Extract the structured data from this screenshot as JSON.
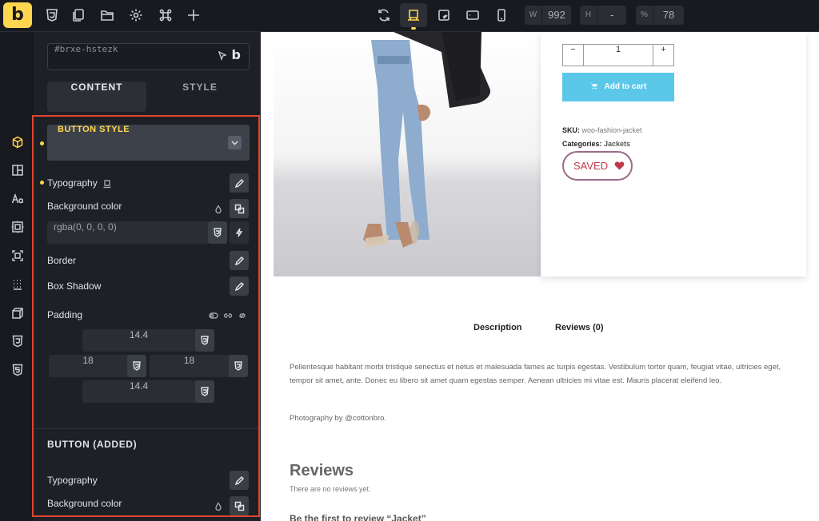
{
  "topbar": {
    "logo": "b",
    "icons": [
      "css3-icon",
      "pages-icon",
      "folder-icon",
      "settings-icon",
      "command-icon",
      "plus-icon"
    ],
    "devices": [
      "refresh-icon",
      "desktop-icon",
      "tablet-landscape-icon",
      "tablet-portrait-icon",
      "mobile-icon"
    ],
    "width_label": "W",
    "width_value": "992",
    "height_label": "H",
    "height_value": "-",
    "zoom_label": "%",
    "zoom_value": "78"
  },
  "panel": {
    "element_id": "#brxe-hstezk",
    "tabs": [
      "CONTENT",
      "STYLE"
    ],
    "section_title": "BUTTON STYLE",
    "fields": {
      "typography": "Typography",
      "background_color": "Background color",
      "bg_value": "rgba(0, 0, 0, 0)",
      "border": "Border",
      "box_shadow": "Box Shadow",
      "padding": "Padding"
    },
    "padding": {
      "top": "14.4",
      "left": "18",
      "right": "18",
      "bottom": "14.4"
    },
    "section2_title": "BUTTON (ADDED)",
    "section2_typography": "Typography",
    "section2_background": "Background color"
  },
  "preview": {
    "qty_minus": "−",
    "qty_value": "1",
    "qty_plus": "+",
    "add_to_cart": "Add to cart",
    "sku_label": "SKU:",
    "sku_value": "woo-fashion-jacket",
    "categories_label": "Categories:",
    "categories_value": "Jackets",
    "saved_label": "SAVED",
    "tab_description": "Description",
    "tab_reviews": "Reviews (0)",
    "description": "Pellentesque habitant morbi tristique senectus et netus et malesuada fames ac turpis egestas. Vestibulum tortor quam, feugiat vitae, ultricies eget, tempor sit amet, ante. Donec eu libero sit amet quam egestas semper. Aenean ultricies mi vitae est. Mauris placerat eleifend leo.",
    "credit": "Photography by @cottonbro.",
    "reviews_heading": "Reviews",
    "no_reviews": "There are no reviews yet.",
    "first_review": "Be the first to review “Jacket”"
  },
  "colors": {
    "accent": "#ffd64f",
    "highlight": "#e0452f",
    "cart": "#5bc8ea"
  }
}
